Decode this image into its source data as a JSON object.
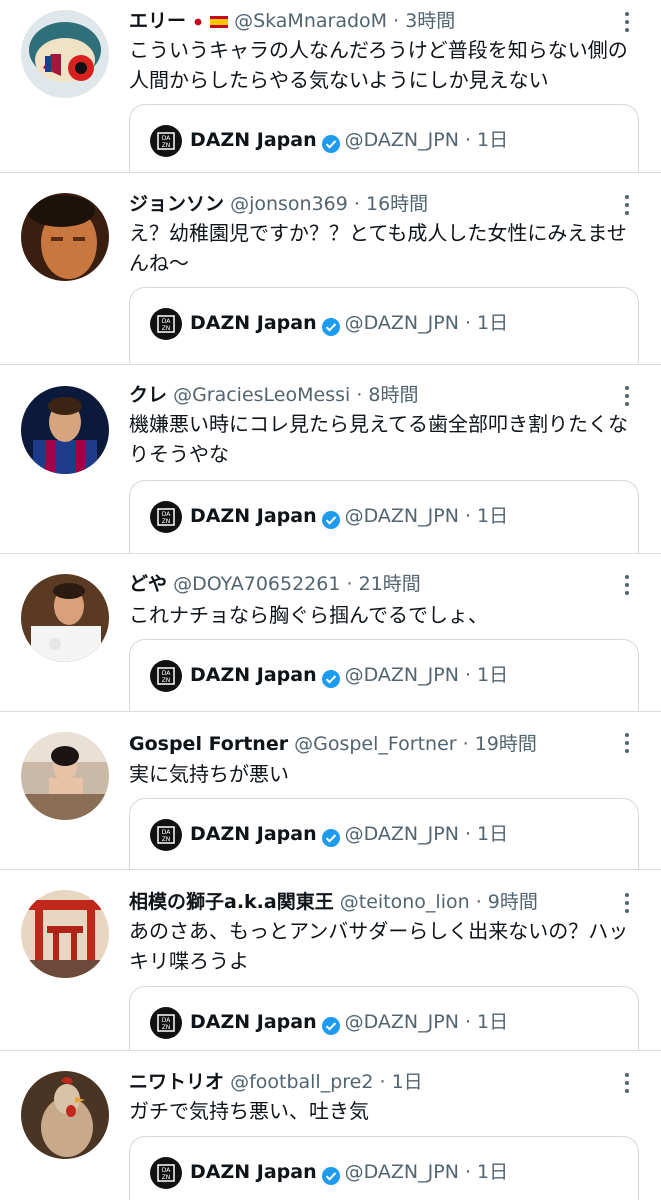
{
  "tweets": [
    {
      "name": "エリー",
      "handle": "@SkaMnaradoM",
      "time": "3時間",
      "text": "こういうキャラの人なんだろうけど普段を知らない側の人間からしたらやる気ないようにしか見えない",
      "quote": {
        "name": "DAZN Japan",
        "handle": "@DAZN_JPN",
        "time": "1日"
      }
    },
    {
      "name": "ジョンソン",
      "handle": "@jonson369",
      "time": "16時間",
      "text": "え？幼稚園児ですか？？とても成人した女性にみえませんね〜",
      "quote": {
        "name": "DAZN Japan",
        "handle": "@DAZN_JPN",
        "time": "1日"
      }
    },
    {
      "name": "クレ",
      "handle": "@GraciesLeoMessi",
      "time": "8時間",
      "text": "機嫌悪い時にコレ見たら見えてる歯全部叩き割りたくなりそうやな",
      "quote": {
        "name": "DAZN Japan",
        "handle": "@DAZN_JPN",
        "time": "1日"
      }
    },
    {
      "name": "どや",
      "handle": "@DOYA70652261",
      "time": "21時間",
      "text": "これナチョなら胸ぐら掴んでるでしょ、",
      "quote": {
        "name": "DAZN Japan",
        "handle": "@DAZN_JPN",
        "time": "1日"
      }
    },
    {
      "name": "Gospel Fortner",
      "handle": "@Gospel_Fortner",
      "time": "19時間",
      "text": "実に気持ちが悪い",
      "quote": {
        "name": "DAZN Japan",
        "handle": "@DAZN_JPN",
        "time": "1日"
      }
    },
    {
      "name": "相模の獅子a.k.a関東王",
      "handle": "@teitono_lion",
      "time": "9時間",
      "text": "あのさあ、もっとアンバサダーらしく出来ないの？ハッキリ喋ろうよ",
      "quote": {
        "name": "DAZN Japan",
        "handle": "@DAZN_JPN",
        "time": "1日"
      }
    },
    {
      "name": "ニワトリオ",
      "handle": "@football_pre2",
      "time": "1日",
      "text": "ガチで気持ち悪い、吐き気",
      "quote": {
        "name": "DAZN Japan",
        "handle": "@DAZN_JPN",
        "time": "1日"
      }
    }
  ],
  "separator": "·",
  "colors": {
    "text": "#0f1419",
    "secondary": "#536471",
    "border": "#cfd9de",
    "verified": "#1d9bf0"
  },
  "icons": {
    "more": "more-vertical-icon",
    "verified": "verified-badge-icon",
    "dazn": "dazn-logo-icon"
  }
}
